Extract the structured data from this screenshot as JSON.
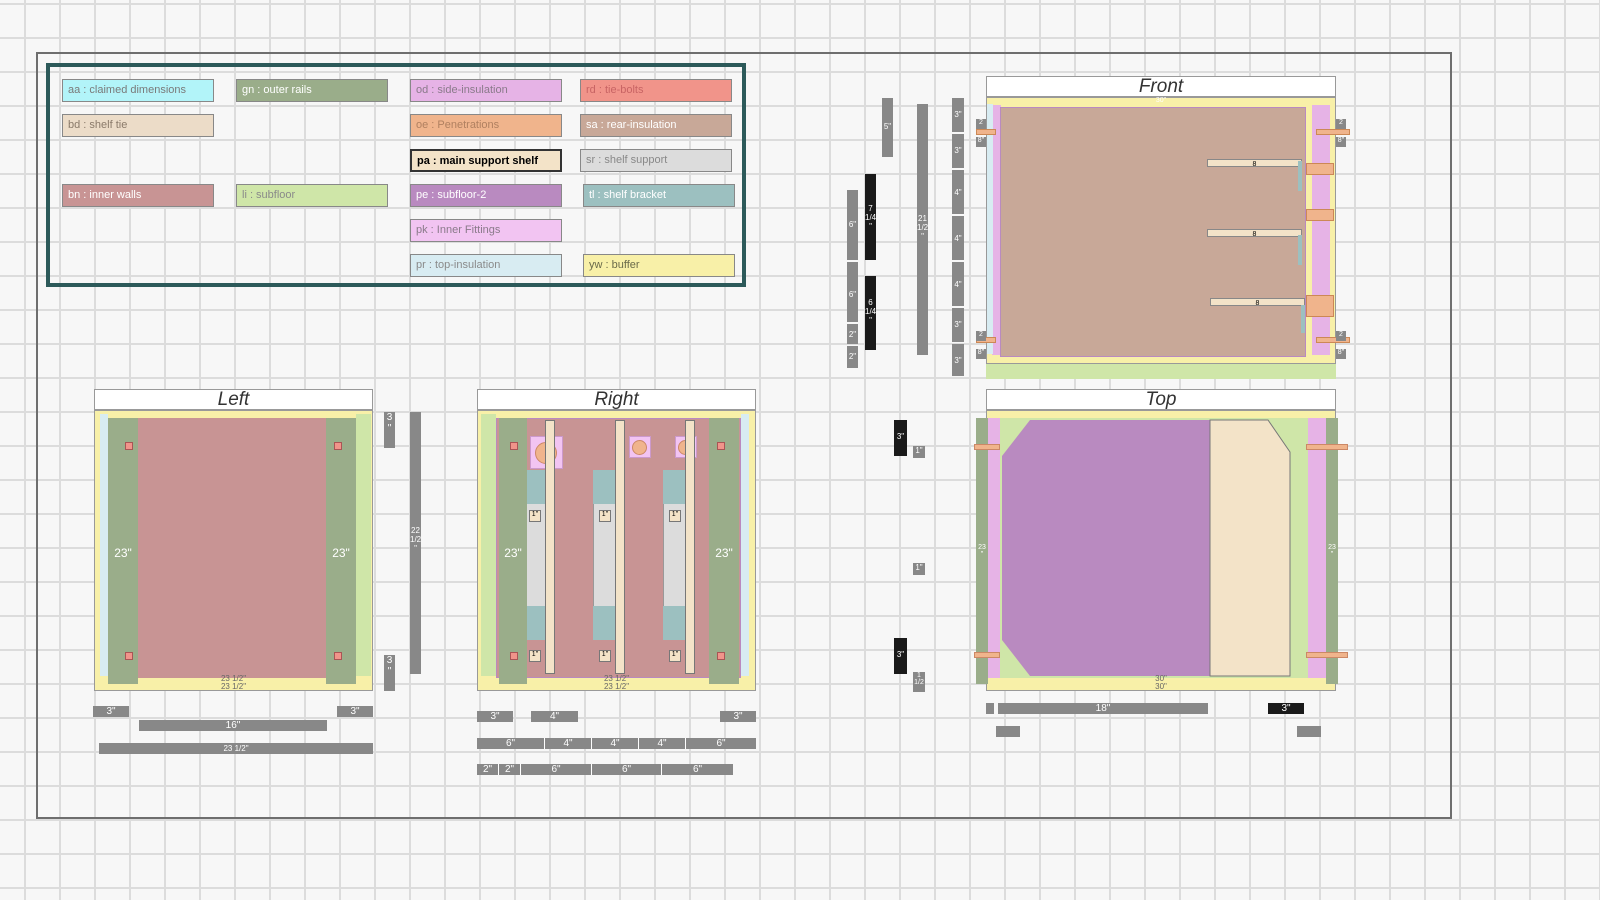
{
  "legend": [
    {
      "code": "aa : claimed dimensions",
      "color": "#b2f4f9"
    },
    {
      "code": "gn : outer rails",
      "color": "#9aad8a"
    },
    {
      "code": "od : side-insulation",
      "color": "#e6b3e6"
    },
    {
      "code": "rd : tie-bolts",
      "color": "#f1948a"
    },
    {
      "code": "bd : shelf tie",
      "color": "#ecdcc8"
    },
    {
      "code": "oe : Penetrations",
      "color": "#f0b48c"
    },
    {
      "code": "sa : rear-insulation",
      "color": "#c8a898"
    },
    {
      "code": "pa : main support shelf",
      "color": "#f3e3c8"
    },
    {
      "code": "sr : shelf support",
      "color": "#dcdcdc"
    },
    {
      "code": "bn : inner walls",
      "color": "#c89494"
    },
    {
      "code": "li : subfloor",
      "color": "#cfe6a8"
    },
    {
      "code": "pe : subfloor-2",
      "color": "#b98ac0"
    },
    {
      "code": "tl : shelf bracket",
      "color": "#9cc0c0"
    },
    {
      "code": "pk : Inner Fittings",
      "color": "#f2c4f2"
    },
    {
      "code": "pr : top-insulation",
      "color": "#d8ecf2"
    },
    {
      "code": "yw : buffer",
      "color": "#f8f0a8"
    }
  ],
  "views": {
    "front": "Front",
    "left": "Left",
    "right": "Right",
    "top": "Top"
  },
  "front": {
    "top_dim": "30\"",
    "bar_5": "5\"",
    "bar_7": "7 1/4 \"",
    "bar_6": "6 1/4 \"",
    "bar_21": "21 1/2 \"",
    "left_col": [
      "6\"",
      "6\"",
      "2\"",
      "2\""
    ],
    "right_col": [
      "3\"",
      "3\"",
      "4\"",
      "4\"",
      "4\"",
      "3\"",
      "3\""
    ],
    "shelf_label": "8",
    "corner": "2",
    "corner_b": "8\""
  },
  "left": {
    "rail": "23\"",
    "side_a": "3 \"",
    "side_b": "3 \"",
    "long_v": "22 1/2 \"",
    "bot_a": "23 1/2\"",
    "bot_b": "23 1/2\"",
    "d1": "3\"",
    "d2": "3\"",
    "d3": "16\"",
    "d4": "23 1/2\""
  },
  "right": {
    "rail": "23\"",
    "bot_a": "23 1/2\"",
    "bot_b": "23 1/2\"",
    "bracket": "1\"",
    "r1": [
      "3\"",
      "4\"",
      "3\""
    ],
    "r2": [
      "6\"",
      "4\"",
      "4\"",
      "4\"",
      "6\""
    ],
    "r3": [
      "2\"",
      "2\"",
      "6\"",
      "6\"",
      "6\""
    ]
  },
  "mid": {
    "b1": "3\"",
    "b2": "3\"",
    "s1": "1\"",
    "s2": "1\"",
    "s3": "1 1/2"
  },
  "top": {
    "d18": "18\"",
    "d3": "3\"",
    "dim30a": "30\"",
    "dim30b": "30\"",
    "side": "23 \""
  }
}
